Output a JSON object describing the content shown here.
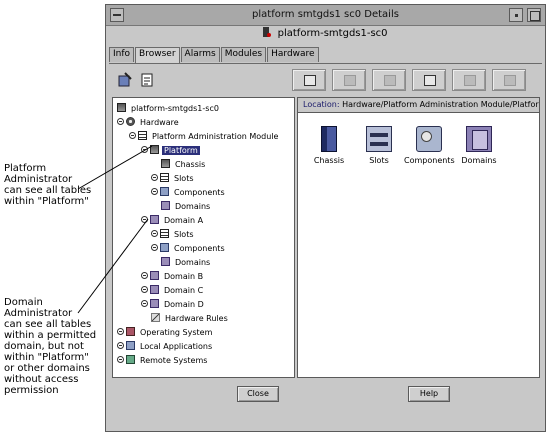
{
  "annotations": {
    "platform_admin": [
      "Platform",
      "Administrator",
      "can see all tables",
      "within  \"Platform\""
    ],
    "domain_admin": [
      "Domain",
      "Administrator",
      "can see all tables",
      "within  a  permitted",
      "domain,  but not",
      "within  \"Platform\"",
      "or other domains",
      "without access",
      "permission"
    ]
  },
  "window": {
    "title": "platform  smtgds1   sc0 Details",
    "subtitle": "platform-smtgds1-sc0"
  },
  "tabs": [
    "Info",
    "Browser",
    "Alarms",
    "Modules",
    "Hardware"
  ],
  "active_tab": "Browser",
  "toolbar": {
    "left_icons": [
      "expand-tree-icon",
      "view-details-icon"
    ],
    "buttons": [
      "properties-button",
      "disabled-button-2",
      "disabled-button-3",
      "table-view-button",
      "disabled-button-5",
      "refresh-button"
    ]
  },
  "tree": {
    "root": "platform-smtgds1-sc0",
    "hardware": "Hardware",
    "platform_admin_module": "Platform Administration Module",
    "platform": "Platform",
    "chassis": "Chassis",
    "slots": "Slots",
    "components": "Components",
    "domains": "Domains",
    "domain_a": "Domain A",
    "domain_a_slots": "Slots",
    "domain_a_components": "Components",
    "domain_a_domains": "Domains",
    "domain_b": "Domain B",
    "domain_c": "Domain C",
    "domain_d": "Domain D",
    "hardware_rules": "Hardware Rules",
    "operating_system": "Operating System",
    "local_applications": "Local Applications",
    "remote_systems": "Remote Systems"
  },
  "location": {
    "label": "Location:",
    "path": "Hardware/Platform Administration Module/Platform"
  },
  "content_icons": [
    {
      "label": "Chassis",
      "icon": "chassis-icon"
    },
    {
      "label": "Slots",
      "icon": "slots-icon"
    },
    {
      "label": "Components",
      "icon": "components-icon"
    },
    {
      "label": "Domains",
      "icon": "domains-icon"
    }
  ],
  "buttons": {
    "close": "Close",
    "help": "Help"
  },
  "colors": {
    "selection": "#2b2f7a",
    "window_bg": "#c8c8c8"
  }
}
